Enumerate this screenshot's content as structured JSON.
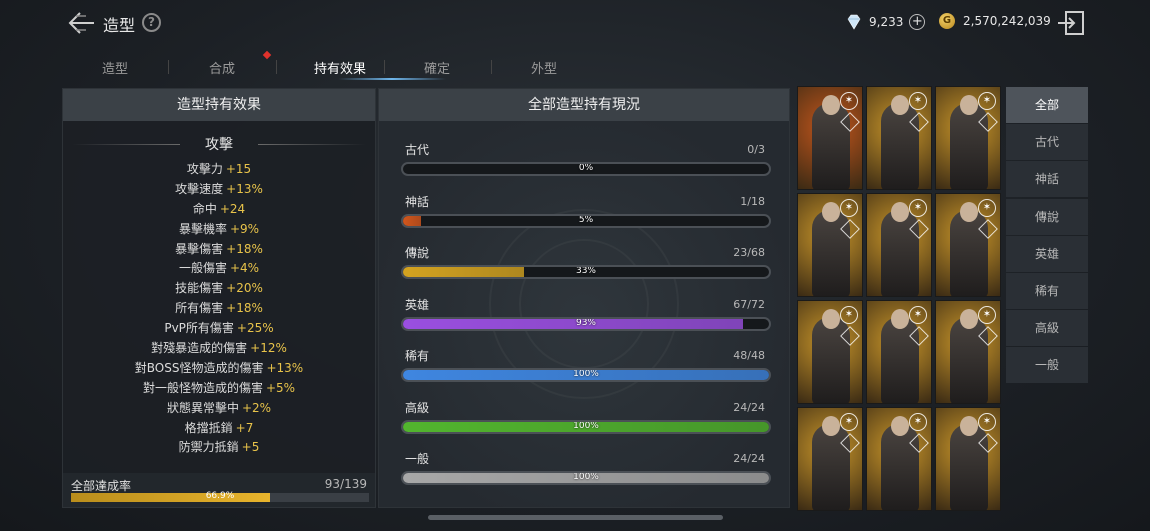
{
  "header": {
    "title": "造型",
    "help_label": "?",
    "diamond_amount": "9,233",
    "gold_amount": "2,570,242,039",
    "gold_symbol": "G",
    "plus_label": "+"
  },
  "tabs": [
    {
      "label": "造型",
      "active": false
    },
    {
      "label": "合成",
      "active": false,
      "notify": true
    },
    {
      "label": "持有效果",
      "active": true
    },
    {
      "label": "確定",
      "active": false
    },
    {
      "label": "外型",
      "active": false
    }
  ],
  "left_panel": {
    "title": "造型持有效果",
    "section_title": "攻擊",
    "stats": [
      {
        "name": "攻擊力",
        "value": "+15"
      },
      {
        "name": "攻擊速度",
        "value": "+13%"
      },
      {
        "name": "命中",
        "value": "+24"
      },
      {
        "name": "暴擊機率",
        "value": "+9%"
      },
      {
        "name": "暴擊傷害",
        "value": "+18%"
      },
      {
        "name": "一般傷害",
        "value": "+4%"
      },
      {
        "name": "技能傷害",
        "value": "+20%"
      },
      {
        "name": "所有傷害",
        "value": "+18%"
      },
      {
        "name": "PvP所有傷害",
        "value": "+25%"
      },
      {
        "name": "對殘暴造成的傷害",
        "value": "+12%"
      },
      {
        "name": "對BOSS怪物造成的傷害",
        "value": "+13%"
      },
      {
        "name": "對一般怪物造成的傷害",
        "value": "+5%"
      },
      {
        "name": "狀態異常擊中",
        "value": "+2%"
      },
      {
        "name": "格擋抵銷",
        "value": "+7"
      },
      {
        "name": "防禦力抵銷",
        "value": "+5"
      }
    ],
    "total_label": "全部達成率",
    "total_count": "93/139",
    "total_percent_label": "66.9%",
    "total_percent": 66.9
  },
  "mid_panel": {
    "title": "全部造型持有現況",
    "grades": [
      {
        "name": "古代",
        "count": "0/3",
        "percent_label": "0%",
        "percent": 0,
        "color": "#888888"
      },
      {
        "name": "神話",
        "count": "1/18",
        "percent_label": "5%",
        "percent": 5,
        "color": "#d2561c"
      },
      {
        "name": "傳說",
        "count": "23/68",
        "percent_label": "33%",
        "percent": 33,
        "color": "#d4a320"
      },
      {
        "name": "英雄",
        "count": "67/72",
        "percent_label": "93%",
        "percent": 93,
        "color": "#9a4fe0"
      },
      {
        "name": "稀有",
        "count": "48/48",
        "percent_label": "100%",
        "percent": 100,
        "color": "#3f86e0"
      },
      {
        "name": "高級",
        "count": "24/24",
        "percent_label": "100%",
        "percent": 100,
        "color": "#52b52e"
      },
      {
        "name": "一般",
        "count": "24/24",
        "percent_label": "100%",
        "percent": 100,
        "color": "#a8a8a8"
      }
    ]
  },
  "character_grid": {
    "cards": [
      {
        "grade": "mythic",
        "bg": "#c4561c"
      },
      {
        "grade": "legend",
        "bg": "#c9962a"
      },
      {
        "grade": "legend",
        "bg": "#c9962a"
      },
      {
        "grade": "legend",
        "bg": "#c9962a"
      },
      {
        "grade": "legend",
        "bg": "#c9962a"
      },
      {
        "grade": "legend",
        "bg": "#c9962a"
      },
      {
        "grade": "legend",
        "bg": "#c9962a"
      },
      {
        "grade": "legend",
        "bg": "#c9962a"
      },
      {
        "grade": "legend",
        "bg": "#c9962a"
      },
      {
        "grade": "legend",
        "bg": "#c9962a"
      },
      {
        "grade": "legend",
        "bg": "#c9962a"
      },
      {
        "grade": "legend",
        "bg": "#c9962a"
      }
    ]
  },
  "filters": [
    {
      "label": "全部",
      "active": true
    },
    {
      "label": "古代",
      "active": false
    },
    {
      "label": "神話",
      "active": false
    },
    {
      "label": "傳說",
      "active": false
    },
    {
      "label": "英雄",
      "active": false
    },
    {
      "label": "稀有",
      "active": false
    },
    {
      "label": "高級",
      "active": false
    },
    {
      "label": "一般",
      "active": false
    }
  ],
  "colors": {
    "accent_gold": "#e8c34a",
    "tab_highlight": "#6fb6ec",
    "notify_red": "#e0322c"
  },
  "icons": [
    "back-arrow-icon",
    "help-icon",
    "diamond-icon",
    "plus-icon",
    "gold-coin-icon",
    "exit-icon",
    "grade-badge-icon"
  ]
}
